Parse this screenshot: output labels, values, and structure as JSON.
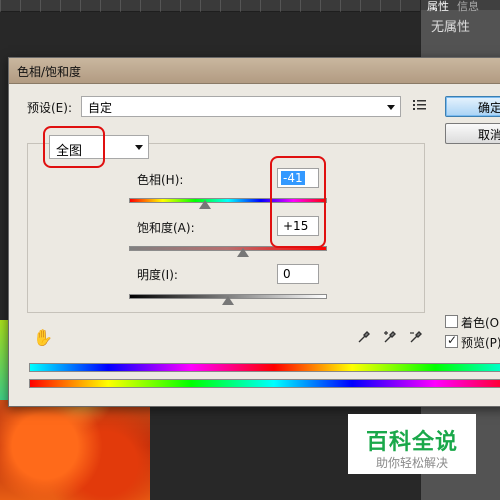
{
  "app": {
    "panel_tabs": [
      "属性",
      "信息"
    ],
    "panel_text": "无属性"
  },
  "dialog": {
    "title": "色相/饱和度",
    "preset_label": "预设(E):",
    "preset_value": "自定",
    "range_value": "全图",
    "ok_label": "确定",
    "cancel_label": "取消",
    "hue_label": "色相(H):",
    "hue_value": "-41",
    "saturation_label": "饱和度(A):",
    "saturation_value": "+15",
    "lightness_label": "明度(I):",
    "lightness_value": "0",
    "colorize_label": "着色(O)",
    "colorize_checked": false,
    "preview_label": "预览(P)",
    "preview_checked": true,
    "hue_slider": {
      "value": -41,
      "min": -180,
      "max": 180
    },
    "saturation_slider": {
      "value": 15,
      "min": -100,
      "max": 100
    },
    "lightness_slider": {
      "value": 0,
      "min": -100,
      "max": 100
    }
  },
  "watermark": {
    "title": "百科全说",
    "subtitle": "助你轻松解决"
  },
  "colors": {
    "highlight_box": "#e01010",
    "ok_button": "#a9d3f5",
    "watermark_green": "#1aa84a"
  }
}
